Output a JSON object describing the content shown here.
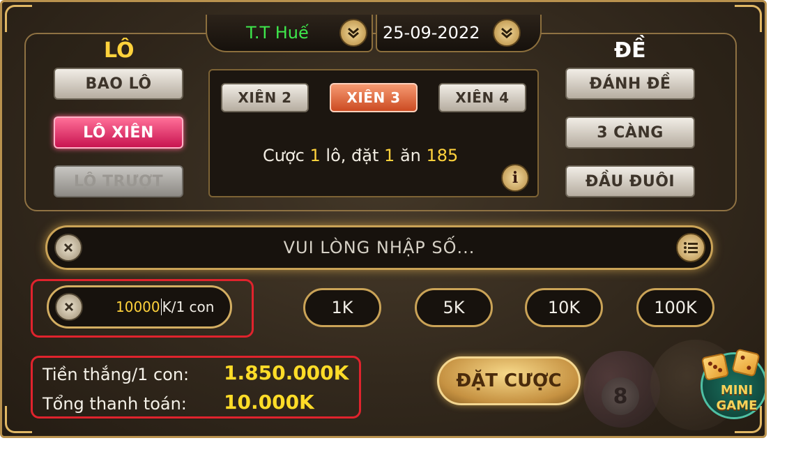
{
  "header": {
    "province": "T.T Huế",
    "date": "25-09-2022",
    "province_color": "#3ee84c"
  },
  "lo": {
    "title": "LÔ",
    "buttons": [
      "BAO LÔ",
      "LÔ XIÊN",
      "LÔ TRƯỢT"
    ],
    "selected": "LÔ XIÊN",
    "disabled": "LÔ TRƯỢT"
  },
  "de": {
    "title": "ĐỀ",
    "buttons": [
      "ĐÁNH ĐỀ",
      "3 CÀNG",
      "ĐẦU ĐUÔI"
    ]
  },
  "xien": {
    "options": [
      "XIÊN 2",
      "XIÊN 3",
      "XIÊN 4"
    ],
    "selected": "XIÊN 3"
  },
  "rule": {
    "prefix": "Cược",
    "bet_count": "1",
    "mid1": "lô, đặt",
    "stake": "1",
    "mid2": "ăn",
    "payout": "185"
  },
  "number_input": {
    "placeholder": "VUI LÒNG NHẬP SỐ..."
  },
  "amount": {
    "value": "10000",
    "unit": "K/1 con"
  },
  "chips": [
    "1K",
    "5K",
    "10K",
    "100K"
  ],
  "summary": {
    "win_label": "Tiền thắng/1 con:",
    "win_value": "1.850.000K",
    "total_label": "Tổng thanh toán:",
    "total_value": "10.000K"
  },
  "submit_label": "ĐẶT CƯỢC",
  "minigame": {
    "line1": "MINI",
    "line2": "GAME"
  },
  "colors": {
    "gold": "#ffd23c",
    "highlight_red": "#e0232d",
    "selected_pink": "#e0245e",
    "selected_orange": "#e06a3e"
  }
}
